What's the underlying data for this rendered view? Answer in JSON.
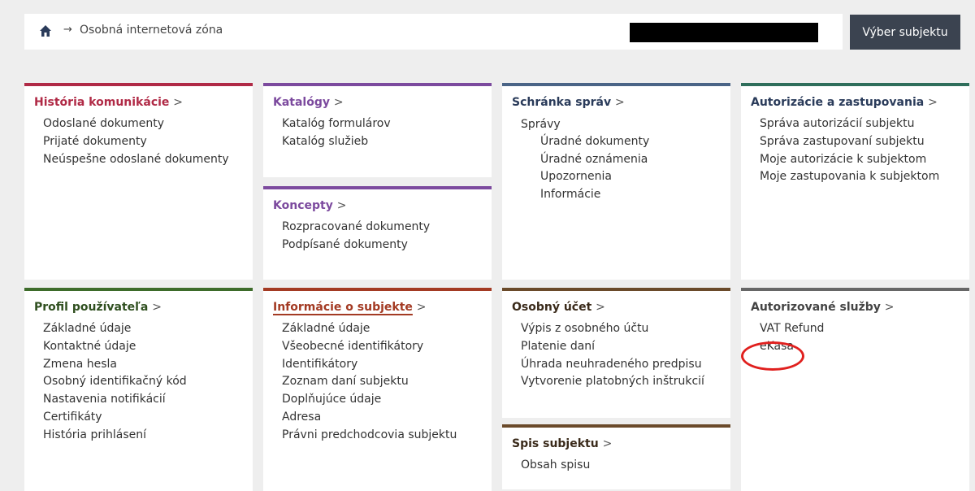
{
  "breadcrumb": {
    "home_icon": "home-icon",
    "arrow": "→",
    "current": "Osobná internetová zóna"
  },
  "header": {
    "select_subject": "Výber subjektu"
  },
  "colors": {
    "historia": "#b02a46",
    "katalogy": "#7c4a9e",
    "schranka": "#4a6486",
    "autorizacie": "#2f6e5b",
    "profil": "#3d6b2a",
    "informacie": "#a33a23",
    "ucet": "#6a4a2a",
    "autorizovane": "#666666",
    "annotation": "#e0201e"
  },
  "panels": {
    "historia": {
      "title": "História komunikácie",
      "gt": ">",
      "links": [
        "Odoslané dokumenty",
        "Prijaté dokumenty",
        "Neúspešne odoslané dokumenty"
      ]
    },
    "katalogy": {
      "title": "Katalógy",
      "gt": ">",
      "links": [
        "Katalóg formulárov",
        "Katalóg služieb"
      ]
    },
    "koncepty": {
      "title": "Koncepty",
      "gt": ">",
      "links": [
        "Rozpracované dokumenty",
        "Podpísané dokumenty"
      ]
    },
    "schranka": {
      "title": "Schránka správ",
      "gt": ">",
      "group_label": "Správy",
      "links": [
        "Úradné dokumenty",
        "Úradné oznámenia",
        "Upozornenia",
        "Informácie"
      ]
    },
    "autorizacie": {
      "title": "Autorizácie a zastupovania",
      "gt": ">",
      "links": [
        "Správa autorizácií subjektu",
        "Správa zastupovaní subjektu",
        "Moje autorizácie k subjektom",
        "Moje zastupovania k subjektom"
      ]
    },
    "profil": {
      "title": "Profil používateľa",
      "gt": ">",
      "links": [
        "Základné údaje",
        "Kontaktné údaje",
        "Zmena hesla",
        "Osobný identifikačný kód",
        "Nastavenia notifikácií",
        "Certifikáty",
        "História prihlásení"
      ]
    },
    "informacie": {
      "title": "Informácie o subjekte",
      "gt": ">",
      "links": [
        "Základné údaje",
        "Všeobecné identifikátory",
        "Identifikátory",
        "Zoznam daní subjektu",
        "Doplňujúce údaje",
        "Adresa",
        "Právni predchodcovia subjektu"
      ]
    },
    "ucet": {
      "title": "Osobný účet",
      "gt": ">",
      "links": [
        "Výpis z osobného účtu",
        "Platenie daní",
        "Úhrada neuhradeného predpisu",
        "Vytvorenie platobných inštrukcií"
      ]
    },
    "spis": {
      "title": "Spis subjektu",
      "gt": ">",
      "links": [
        "Obsah spisu"
      ]
    },
    "autorizovane": {
      "title": "Autorizované služby",
      "gt": ">",
      "links": [
        "VAT Refund",
        "eKasa"
      ]
    }
  }
}
